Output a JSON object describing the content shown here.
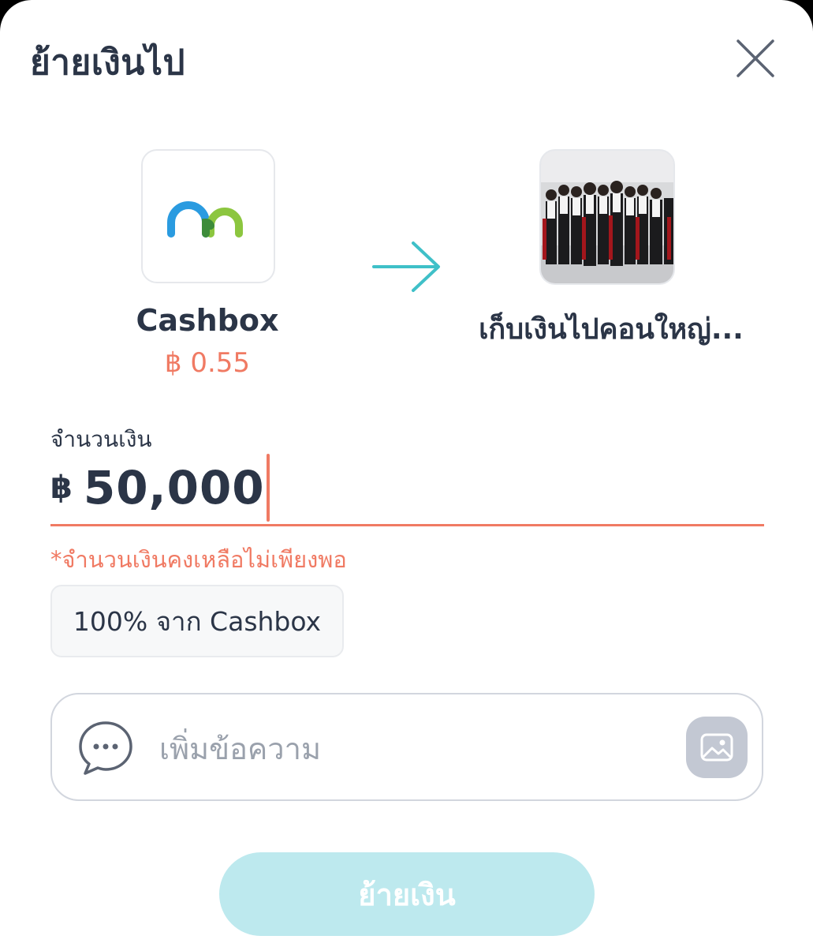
{
  "header": {
    "title": "ย้ายเงินไป"
  },
  "source": {
    "name": "Cashbox",
    "balance": "฿ 0.55"
  },
  "destination": {
    "name": "เก็บเงินไปคอนใหญ่..."
  },
  "amount": {
    "label": "จำนวนเงิน",
    "currency": "฿",
    "value": "50,000"
  },
  "error_text": "*จำนวนเงินคงเหลือไม่เพียงพอ",
  "quick_chip": {
    "label": "100% จาก Cashbox"
  },
  "message": {
    "placeholder": "เพิ่มข้อความ"
  },
  "submit": {
    "label": "ย้ายเงิน"
  },
  "colors": {
    "accent_error": "#f07a63",
    "arrow": "#3fc0c8",
    "submit_disabled": "#bde9ee",
    "text_primary": "#2b3547",
    "logo_blue": "#2a9be0",
    "logo_green": "#8cc63f"
  },
  "icons": [
    "close-icon",
    "arrow-right-icon",
    "chat-bubble-icon",
    "image-icon",
    "cashbox-logo"
  ]
}
